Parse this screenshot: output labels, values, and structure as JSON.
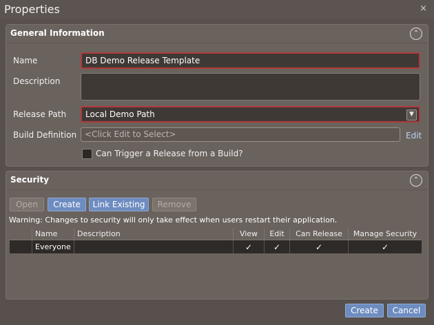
{
  "window": {
    "title": "Properties",
    "close_glyph": "×"
  },
  "general": {
    "title": "General Information",
    "collapse_glyph": "⌃",
    "name_label": "Name",
    "name_value": "DB Demo Release Template",
    "description_label": "Description",
    "description_value": "",
    "release_path_label": "Release Path",
    "release_path_value": "Local Demo Path",
    "build_definition_label": "Build Definition",
    "build_definition_placeholder": "<Click Edit to Select>",
    "edit_link": "Edit",
    "trigger_label": "Can Trigger a Release from a Build?",
    "trigger_checked": false
  },
  "security": {
    "title": "Security",
    "collapse_glyph": "⌃",
    "buttons": {
      "open": "Open",
      "create": "Create",
      "link_existing": "Link Existing",
      "remove": "Remove"
    },
    "warning": "Warning: Changes to security will only take effect when users restart their application.",
    "columns": [
      "",
      "Name",
      "Description",
      "View",
      "Edit",
      "Can Release",
      "Manage Security"
    ],
    "rows": [
      {
        "name": "Everyone",
        "description": "",
        "view": "✓",
        "edit": "✓",
        "can_release": "✓",
        "manage_security": "✓"
      }
    ]
  },
  "footer": {
    "create": "Create",
    "cancel": "Cancel"
  },
  "colors": {
    "background": "#57504c",
    "panel": "#6a625d",
    "accent": "#6d8cc0",
    "required_border": "#b03a3a"
  }
}
